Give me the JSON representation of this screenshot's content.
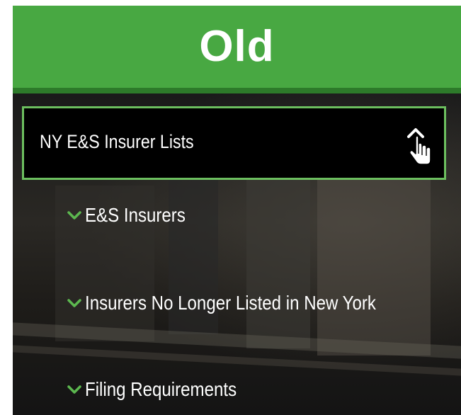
{
  "banner": {
    "title": "Old",
    "color": "#48a842"
  },
  "accordion": {
    "label": "NY E&S Insurer Lists",
    "expanded": true,
    "border_color": "#6cbf5f",
    "toggle_icon": "chevron-up-icon",
    "cursor_icon": "hand-pointer-icon"
  },
  "submenu": {
    "chevron_icon": "chevron-down-icon",
    "chevron_color": "#5cb84f",
    "items": [
      {
        "label": "E&S Insurers"
      },
      {
        "label": "Insurers No Longer Listed in New York"
      },
      {
        "label": "Filing Requirements"
      }
    ]
  }
}
